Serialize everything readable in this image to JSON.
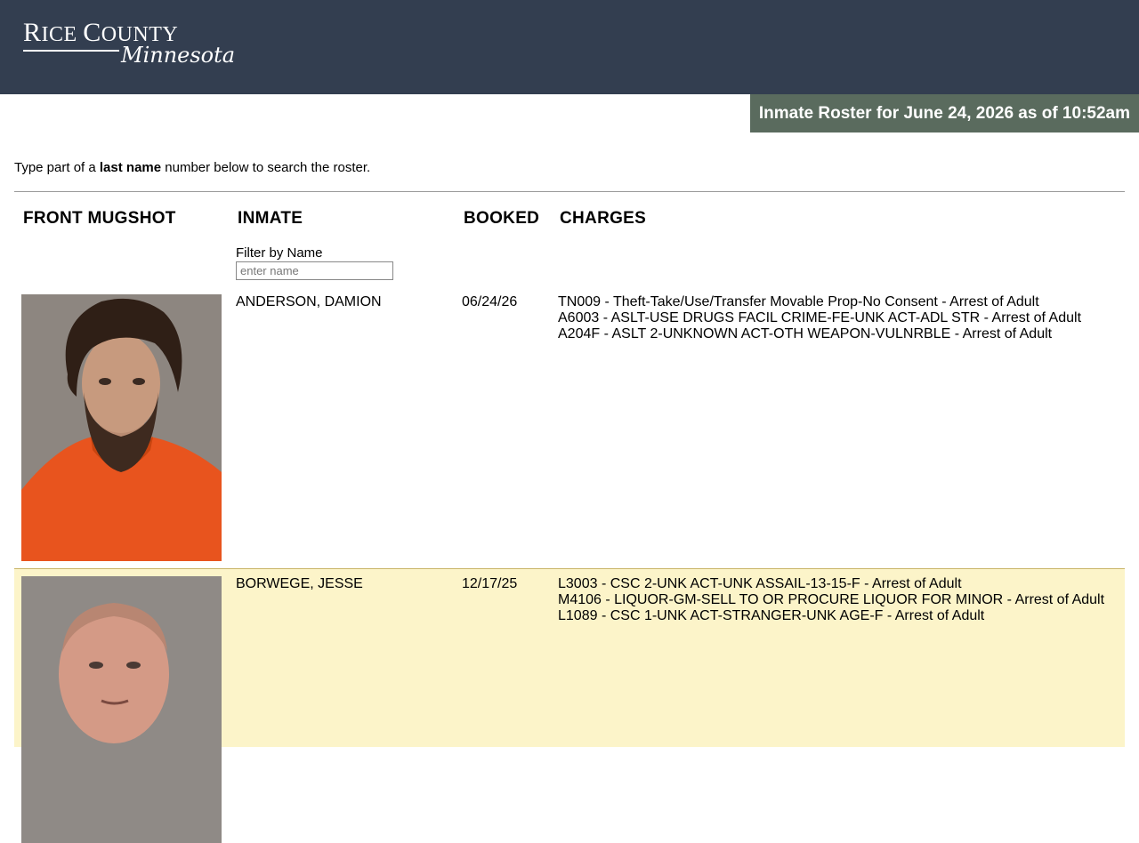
{
  "logo": {
    "line1_cap1": "R",
    "line1_rest1": "ICE ",
    "line1_cap2": "C",
    "line1_rest2": "OUNTY",
    "line2": "Minnesota"
  },
  "banner": "Inmate Roster for June 24, 2026 as of 10:52am",
  "intro": {
    "before": "Type part of a ",
    "bold": "last name",
    "after": " number below to search the roster."
  },
  "columns": {
    "mugshot": "FRONT MUGSHOT",
    "inmate": "INMATE",
    "booked": "BOOKED",
    "charges": "CHARGES"
  },
  "filter": {
    "label": "Filter by Name",
    "placeholder": "enter name",
    "value": ""
  },
  "inmates": [
    {
      "name": "ANDERSON, DAMION",
      "booked": "06/24/26",
      "charges": [
        "TN009 - Theft-Take/Use/Transfer Movable Prop-No Consent - Arrest of Adult",
        "A6003 - ASLT-USE DRUGS FACIL CRIME-FE-UNK ACT-ADL STR - Arrest of Adult",
        "A204F - ASLT 2-UNKNOWN ACT-OTH WEAPON-VULNRBLE - Arrest of Adult"
      ]
    },
    {
      "name": "BORWEGE, JESSE",
      "booked": "12/17/25",
      "charges": [
        "L3003 - CSC 2-UNK ACT-UNK ASSAIL-13-15-F - Arrest of Adult",
        "M4106 - LIQUOR-GM-SELL TO OR PROCURE LIQUOR FOR MINOR - Arrest of Adult",
        "L1089 - CSC 1-UNK ACT-STRANGER-UNK AGE-F - Arrest of Adult"
      ]
    }
  ]
}
